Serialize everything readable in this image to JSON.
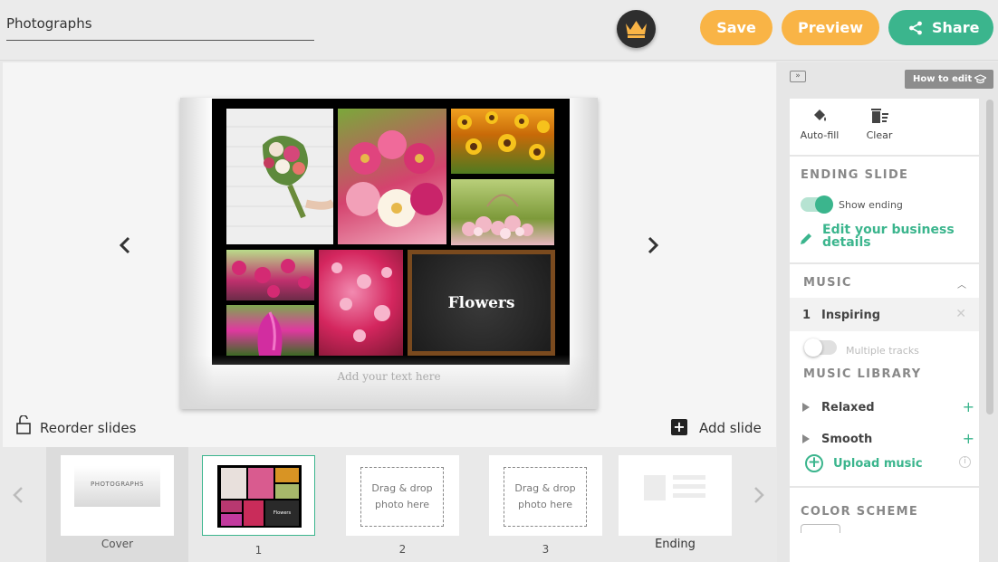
{
  "header": {
    "title_value": "Photographs",
    "save_label": "Save",
    "preview_label": "Preview",
    "share_label": "Share",
    "crown_icon": "crown-icon",
    "colors": {
      "save": "#f9b446",
      "preview": "#f9b446",
      "share": "#3bb58d"
    }
  },
  "stage": {
    "collage_title": "Flowers",
    "caption_placeholder": "Add your text here",
    "reorder_label": "Reorder slides",
    "add_slide_label": "Add slide"
  },
  "filmstrip": {
    "cover_label": "Cover",
    "cover_title": "PHOTOGRAPHS",
    "slide_labels": [
      "1",
      "2",
      "3"
    ],
    "drop_text": "Drag & drop photo here",
    "ending_label": "Ending"
  },
  "panel": {
    "howto_label": "How to edit",
    "autofill_label": "Auto-fill",
    "clear_label": "Clear",
    "ending_section": "ENDING SLIDE",
    "show_ending_label": "Show ending",
    "show_ending_on": true,
    "edit_business_label": "Edit your business details",
    "music_section": "MUSIC",
    "track": {
      "number": "1",
      "name": "Inspiring"
    },
    "multiple_tracks_label": "Multiple tracks",
    "multiple_tracks_on": false,
    "library_section": "MUSIC LIBRARY",
    "library_items": [
      "Relaxed",
      "Smooth"
    ],
    "upload_label": "Upload music",
    "color_section": "COLOR SCHEME"
  }
}
